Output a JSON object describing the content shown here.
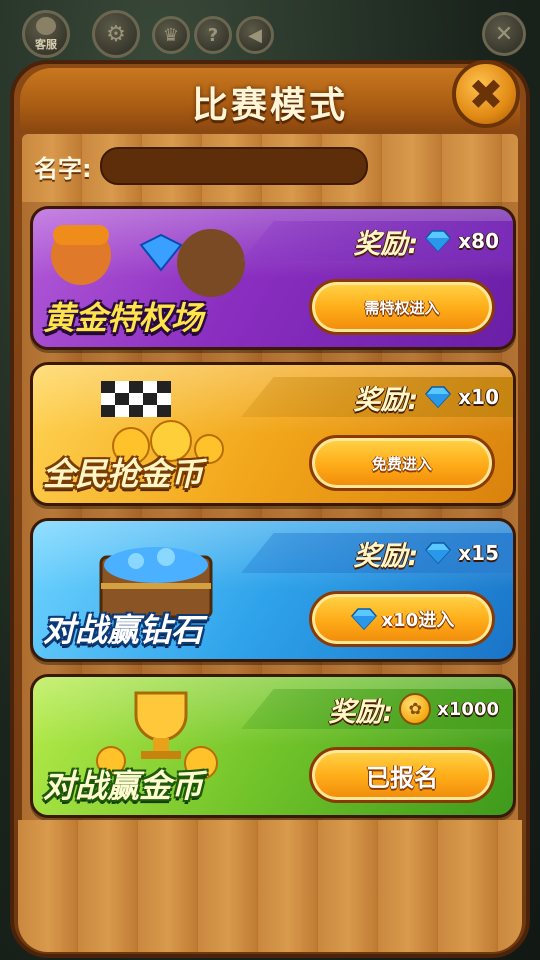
{
  "hud": {
    "kefu_label": "客服",
    "settings_icon": "gear-icon",
    "trophy_icon": "trophy-icon",
    "help_icon": "help-icon",
    "sound_icon": "speaker-icon",
    "close_icon": "close-icon"
  },
  "dialog": {
    "title": "比赛模式",
    "close_icon": "close-icon",
    "name_label": "名字:",
    "name_value": ""
  },
  "modes": [
    {
      "title": "黄金特权场",
      "reward_label": "奖励:",
      "reward_icon": "diamond-icon",
      "reward_amount": "x80",
      "button_label": "需特权进入",
      "color": "#8a2ec0"
    },
    {
      "title": "全民抢金币",
      "reward_label": "奖励:",
      "reward_icon": "diamond-icon",
      "reward_amount": "x10",
      "button_label": "免费进入",
      "color": "#f2a61a"
    },
    {
      "title": "对战赢钻石",
      "reward_label": "奖励:",
      "reward_icon": "diamond-icon",
      "reward_amount": "x15",
      "button_icon": "diamond-icon",
      "button_label": "x10进入",
      "color": "#2ea2ea"
    },
    {
      "title": "对战赢金币",
      "reward_label": "奖励:",
      "reward_icon": "coin-icon",
      "reward_amount": "x1000",
      "button_label": "已报名",
      "color": "#72c42a"
    }
  ],
  "colors": {
    "panel_wood": "#8b4a16",
    "button_orange": "#ffae1a",
    "title_text": "#fff6d8"
  }
}
